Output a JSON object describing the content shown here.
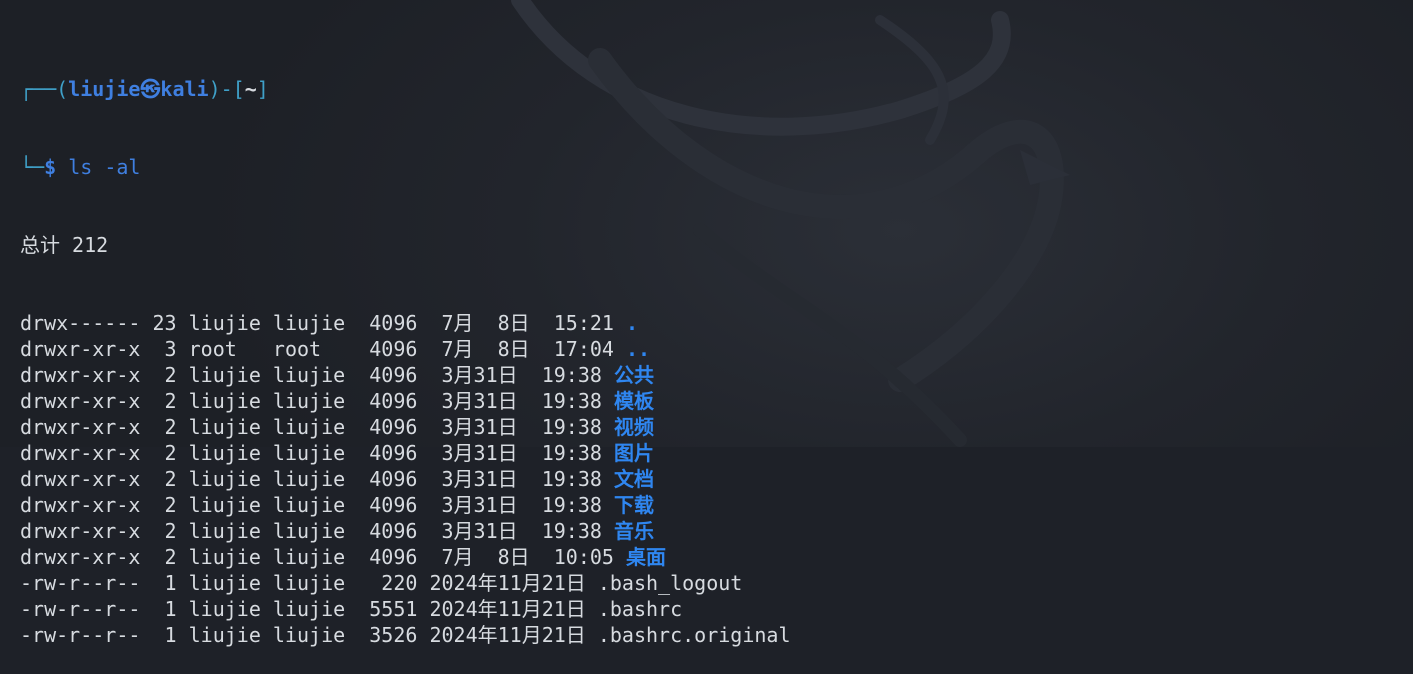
{
  "prompt": {
    "frame_top_left": "┌──(",
    "user": "liujie",
    "at_symbol": "㉿",
    "host": "kali",
    "frame_mid": ")-[",
    "cwd": "~",
    "frame_close": "]",
    "frame_bottom": "└─",
    "dollar": "$",
    "command": "ls",
    "args": "-al"
  },
  "listing": {
    "total_line": "总计 212",
    "entries": [
      {
        "perms": "drwx------",
        "links": "23",
        "owner": "liujie",
        "group": "liujie",
        "size": "4096",
        "date": " 7月  8日  15:21",
        "name": ".",
        "kind": "dir"
      },
      {
        "perms": "drwxr-xr-x",
        "links": " 3",
        "owner": "root  ",
        "group": "root  ",
        "size": "4096",
        "date": " 7月  8日  17:04",
        "name": "..",
        "kind": "dir"
      },
      {
        "perms": "drwxr-xr-x",
        "links": " 2",
        "owner": "liujie",
        "group": "liujie",
        "size": "4096",
        "date": " 3月31日  19:38",
        "name": "公共",
        "kind": "dir"
      },
      {
        "perms": "drwxr-xr-x",
        "links": " 2",
        "owner": "liujie",
        "group": "liujie",
        "size": "4096",
        "date": " 3月31日  19:38",
        "name": "模板",
        "kind": "dir"
      },
      {
        "perms": "drwxr-xr-x",
        "links": " 2",
        "owner": "liujie",
        "group": "liujie",
        "size": "4096",
        "date": " 3月31日  19:38",
        "name": "视频",
        "kind": "dir"
      },
      {
        "perms": "drwxr-xr-x",
        "links": " 2",
        "owner": "liujie",
        "group": "liujie",
        "size": "4096",
        "date": " 3月31日  19:38",
        "name": "图片",
        "kind": "dir"
      },
      {
        "perms": "drwxr-xr-x",
        "links": " 2",
        "owner": "liujie",
        "group": "liujie",
        "size": "4096",
        "date": " 3月31日  19:38",
        "name": "文档",
        "kind": "dir"
      },
      {
        "perms": "drwxr-xr-x",
        "links": " 2",
        "owner": "liujie",
        "group": "liujie",
        "size": "4096",
        "date": " 3月31日  19:38",
        "name": "下载",
        "kind": "dir"
      },
      {
        "perms": "drwxr-xr-x",
        "links": " 2",
        "owner": "liujie",
        "group": "liujie",
        "size": "4096",
        "date": " 3月31日  19:38",
        "name": "音乐",
        "kind": "dir"
      },
      {
        "perms": "drwxr-xr-x",
        "links": " 2",
        "owner": "liujie",
        "group": "liujie",
        "size": "4096",
        "date": " 7月  8日  10:05",
        "name": "桌面",
        "kind": "dir"
      },
      {
        "perms": "-rw-r--r--",
        "links": " 1",
        "owner": "liujie",
        "group": "liujie",
        "size": " 220",
        "date": "2024年11月21日",
        "name": ".bash_logout",
        "kind": "file"
      },
      {
        "perms": "-rw-r--r--",
        "links": " 1",
        "owner": "liujie",
        "group": "liujie",
        "size": "5551",
        "date": "2024年11月21日",
        "name": ".bashrc",
        "kind": "file"
      },
      {
        "perms": "-rw-r--r--",
        "links": " 1",
        "owner": "liujie",
        "group": "liujie",
        "size": "3526",
        "date": "2024年11月21日",
        "name": ".bashrc.original",
        "kind": "file"
      }
    ]
  },
  "colors": {
    "background": "#1e2128",
    "text": "#d7dbe0",
    "prompt_accent": "#3f7fe0",
    "directory": "#2f86f0"
  }
}
